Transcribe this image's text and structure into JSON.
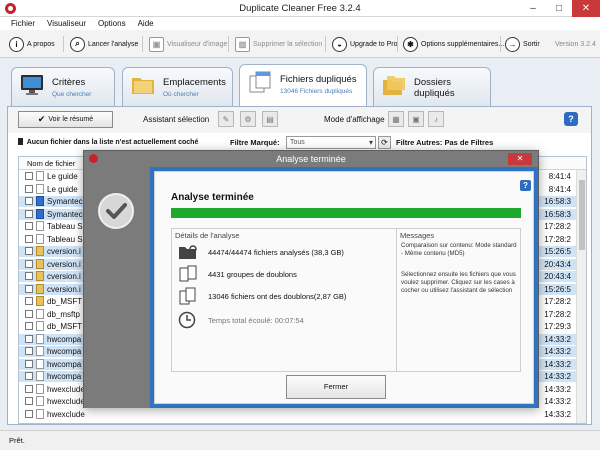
{
  "window": {
    "title": "Duplicate Cleaner Free 3.2.4",
    "minimize": "–",
    "maximize": "□",
    "close": "✕"
  },
  "menu": [
    "Fichier",
    "Visualiseur",
    "Options",
    "Aide"
  ],
  "toolbar": {
    "about": "A propos",
    "scan": "Lancer l'analyse",
    "viewer": "Visualiseur d'image",
    "delete": "Supprimer la sélection",
    "upgrade": "Upgrade to Pro",
    "options": "Options supplémentaires...",
    "exit": "Sortir",
    "version": "Version 3.2.4"
  },
  "tabs": [
    {
      "label": "Critères",
      "sub": "Que chercher"
    },
    {
      "label": "Emplacements",
      "sub": "Où chercher"
    },
    {
      "label": "Fichiers dupliqués",
      "sub": "13046 Fichiers dupliqués"
    },
    {
      "label": "Dossiers dupliqués",
      "sub": ""
    }
  ],
  "options_row": {
    "summary_button": "Voir le résumé",
    "assistant_label": "Assistant sélection",
    "display_mode_label": "Mode d'affichage"
  },
  "filter_row": {
    "no_file_text": "Aucun fichier dans la liste n'est actuellement coché",
    "marked_filter_label": "Filtre Marqué:",
    "marked_filter_value": "Tous",
    "other_filters_label": "Filtre Autres: Pas de Filtres"
  },
  "list": {
    "column_name": "Nom de fichier",
    "rows": [
      {
        "name": "Le guide",
        "time": "8:41:4",
        "selected": false,
        "icon": "doc"
      },
      {
        "name": "Le guide",
        "time": "8:41:4",
        "selected": false,
        "icon": "doc"
      },
      {
        "name": "Symantec",
        "time": "16:58:3",
        "selected": true,
        "icon": "blue"
      },
      {
        "name": "Symantec",
        "time": "16:58:3",
        "selected": true,
        "icon": "blue"
      },
      {
        "name": "Tableau S",
        "time": "17:28:2",
        "selected": false,
        "icon": "doc"
      },
      {
        "name": "Tableau S",
        "time": "17:28:2",
        "selected": false,
        "icon": "doc"
      },
      {
        "name": "cversion.i",
        "time": "15:26:5",
        "selected": true,
        "icon": "folder"
      },
      {
        "name": "cversion.i",
        "time": "20:43:4",
        "selected": true,
        "icon": "folder"
      },
      {
        "name": "cversion.i",
        "time": "20:43:4",
        "selected": true,
        "icon": "folder"
      },
      {
        "name": "cversion.i",
        "time": "15:26:5",
        "selected": true,
        "icon": "folder"
      },
      {
        "name": "db_MSFT",
        "time": "17:28:2",
        "selected": false,
        "icon": "folder"
      },
      {
        "name": "db_msftp",
        "time": "17:28:2",
        "selected": false,
        "icon": "doc"
      },
      {
        "name": "db_MSFT",
        "time": "17:29:3",
        "selected": false,
        "icon": "doc"
      },
      {
        "name": "hwcompa",
        "time": "14:33:2",
        "selected": true,
        "icon": "doc"
      },
      {
        "name": "hwcompa",
        "time": "14:33:2",
        "selected": true,
        "icon": "doc"
      },
      {
        "name": "hwcompa",
        "time": "14:33:2",
        "selected": true,
        "icon": "doc"
      },
      {
        "name": "hwcompa",
        "time": "14:33:2",
        "selected": true,
        "icon": "doc"
      },
      {
        "name": "hwexclude",
        "time": "14:33:2",
        "selected": false,
        "icon": "doc"
      },
      {
        "name": "hwexclude",
        "time": "14:33:2",
        "selected": false,
        "icon": "doc"
      },
      {
        "name": "hwexclude",
        "time": "14:33:2",
        "selected": false,
        "icon": "doc"
      }
    ]
  },
  "status": "Prêt.",
  "dialog": {
    "title": "Analyse terminée",
    "heading": "Analyse terminée",
    "progress": 1.0,
    "details_title": "Détails de l'analyse",
    "files_scanned": "44474/44474 fichiers analysés (38,3 GB)",
    "groups": "4431 groupes de doublons",
    "duplicates": "13046 fichiers ont des doublons(2,87 GB)",
    "elapsed": "Temps total écoulé: 00:07:54",
    "messages_title": "Messages",
    "message_1": "Comparaison sur contenu: Mode standard - Même contenu (MD5)",
    "message_2": "Sélectionnez ensuite les fichiers que vous voulez supprimer. Cliquez sur les cases à cocher ou utilisez l'assistant de sélection",
    "close_button": "Fermer"
  },
  "colors": {
    "accent": "#2e74c0",
    "progress": "#1ea82e",
    "close_red": "#c7393a",
    "selected_row": "#cfe3f6"
  }
}
